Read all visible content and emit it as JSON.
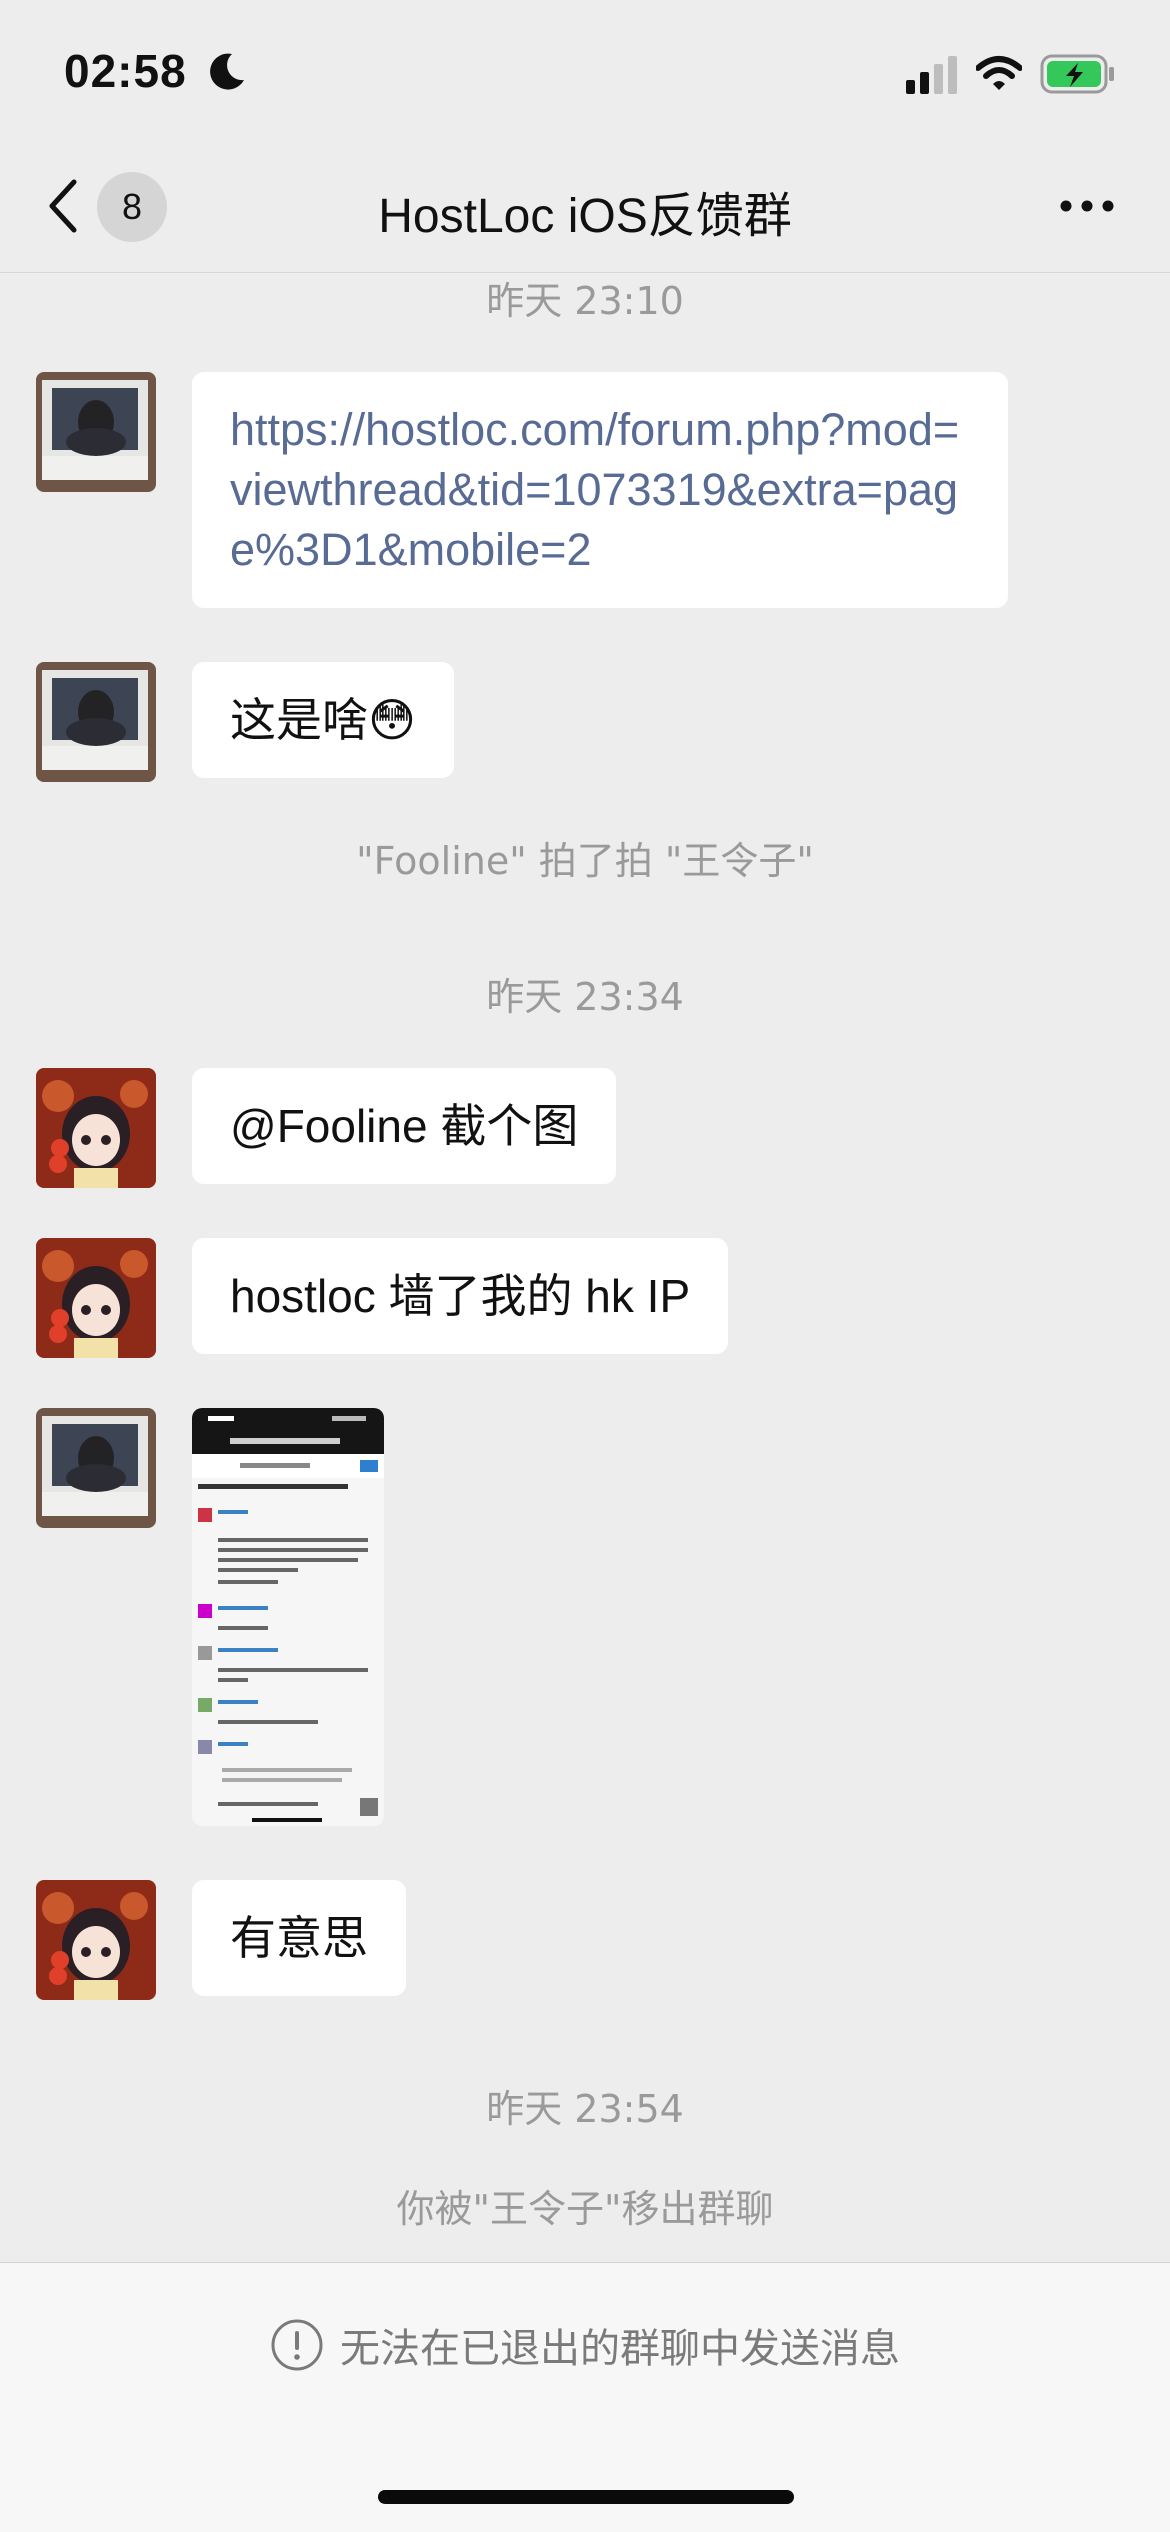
{
  "status_bar": {
    "time": "02:58"
  },
  "header": {
    "title": "HostLoc iOS反馈群",
    "unread_count": "8"
  },
  "timestamps": [
    "昨天 23:10",
    "昨天 23:34",
    "昨天 23:54"
  ],
  "messages": [
    {
      "type": "text",
      "sender": "B",
      "text": "https://hostloc.com/forum.php?mod=viewthread&tid=1073319&extra=page%3D1&mobile=2"
    },
    {
      "type": "text",
      "sender": "B",
      "text": "这是啥😳"
    },
    {
      "type": "system",
      "text": "\"Fooline\" 拍了拍 \"王令子\""
    },
    {
      "type": "text",
      "sender": "A",
      "text": "@Fooline 截个图"
    },
    {
      "type": "text",
      "sender": "A",
      "text": "hostloc 墙了我的 hk IP"
    },
    {
      "type": "image",
      "sender": "B"
    },
    {
      "type": "text",
      "sender": "A",
      "text": "有意思"
    },
    {
      "type": "system",
      "text": "你被\"王令子\"移出群聊"
    }
  ],
  "footer": {
    "text": "无法在已退出的群聊中发送消息"
  },
  "colors": {
    "background": "#ededed",
    "link": "#576b95",
    "bubble": "#ffffff",
    "muted": "#9a9a9a"
  }
}
